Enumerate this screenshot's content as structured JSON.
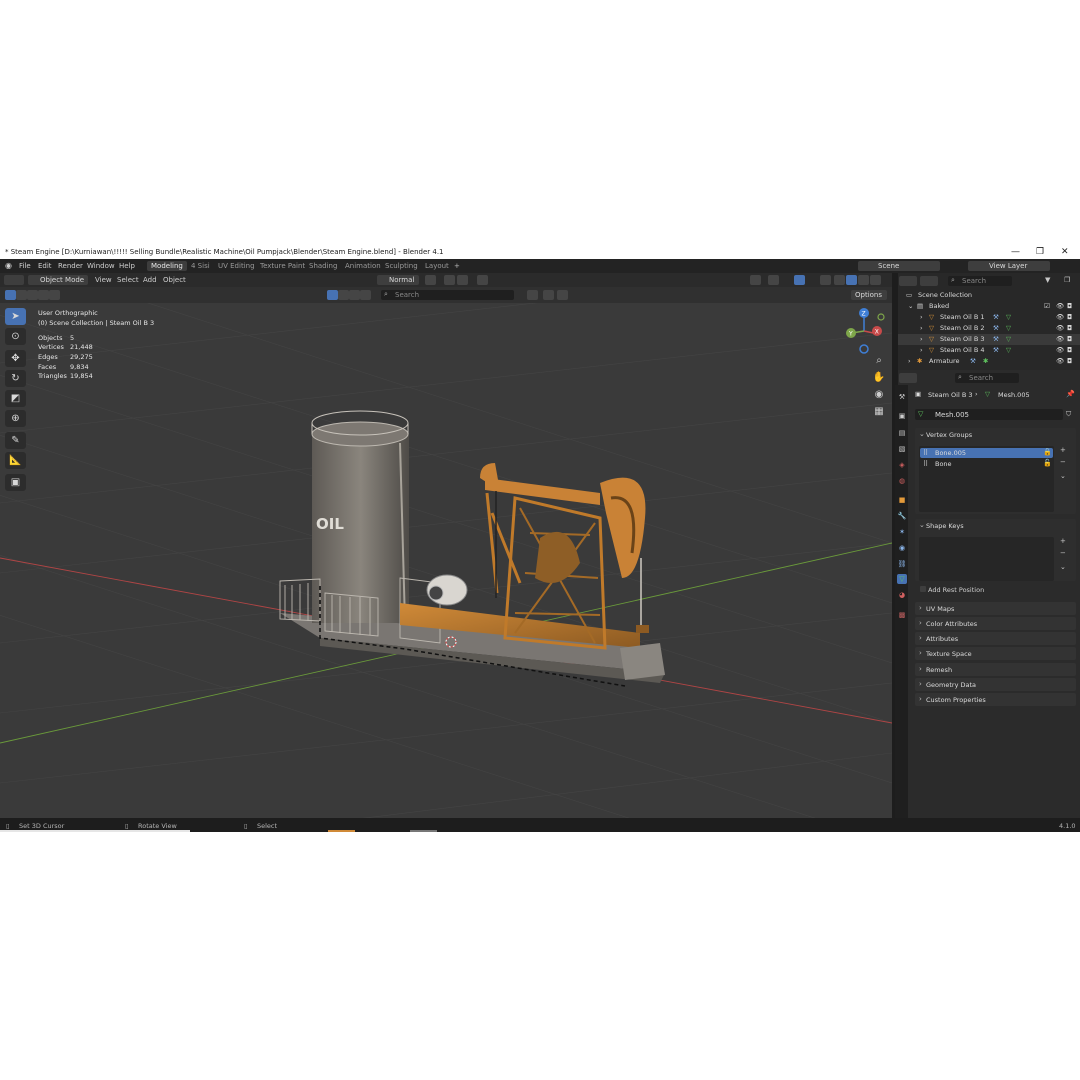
{
  "window": {
    "title": "* Steam Engine [D:\\Kurniawan\\!!!!! Selling Bundle\\Realistic Machine\\Oil Pumpjack\\Blender\\Steam Engine.blend] - Blender 4.1",
    "controls": [
      "—",
      "❐",
      "✕"
    ]
  },
  "menubar": {
    "menus": [
      "File",
      "Edit",
      "Render",
      "Window",
      "Help"
    ],
    "workspaces": [
      "Modeling",
      "4 Sisi",
      "UV Editing",
      "Texture Paint",
      "Shading",
      "Animation",
      "Sculpting",
      "Layout"
    ],
    "active_workspace": "Modeling",
    "add_tab": "+",
    "scene_label": "Scene",
    "view_layer_label": "View Layer"
  },
  "viewport_header": {
    "mode": "Object Mode",
    "menus": [
      "View",
      "Select",
      "Add",
      "Object"
    ],
    "orientation": "Normal",
    "options": "Options",
    "search_placeholder": "Search"
  },
  "viewport": {
    "view_name": "User Orthographic",
    "collection_line": "(0) Scene Collection | Steam Oil B 3",
    "stats": [
      {
        "label": "Objects",
        "value": "5"
      },
      {
        "label": "Vertices",
        "value": "21,448"
      },
      {
        "label": "Edges",
        "value": "29,275"
      },
      {
        "label": "Faces",
        "value": "9,834"
      },
      {
        "label": "Triangles",
        "value": "19,854"
      }
    ],
    "tank_label": "OIL",
    "gizmo_axes": {
      "z": "Z",
      "y": "Y",
      "x": "X"
    }
  },
  "outliner": {
    "search_placeholder": "Search",
    "root": "Scene Collection",
    "collection": "Baked",
    "objects": [
      "Steam Oil B 1",
      "Steam Oil B 2",
      "Steam Oil B 3",
      "Steam Oil B 4",
      "Armature"
    ]
  },
  "properties": {
    "search_placeholder": "Search",
    "breadcrumb_object": "Steam Oil B 3",
    "breadcrumb_mesh": "Mesh.005",
    "mesh_name": "Mesh.005",
    "vertex_groups_title": "Vertex Groups",
    "vertex_groups": [
      "Bone.005",
      "Bone"
    ],
    "shape_keys_title": "Shape Keys",
    "add_rest_position": "Add Rest Position",
    "collapsed_panels": [
      "UV Maps",
      "Color Attributes",
      "Attributes",
      "Texture Space",
      "Remesh",
      "Geometry Data",
      "Custom Properties"
    ]
  },
  "statusbar": {
    "items": [
      "Set 3D Cursor",
      "Rotate View",
      "Select"
    ],
    "version": "4.1.0"
  },
  "colors": {
    "accent": "#4772b3",
    "rust": "#c07a2a",
    "x_axis": "#c84a4a",
    "y_axis": "#7ea64a",
    "z_axis": "#3f7fd6"
  }
}
